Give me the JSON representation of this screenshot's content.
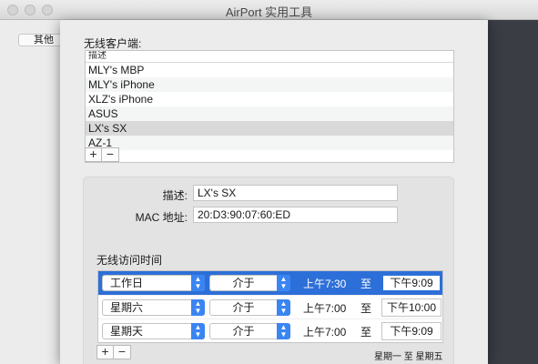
{
  "window": {
    "title": "AirPort 实用工具"
  },
  "background": {
    "other_button_label": "其他"
  },
  "clients": {
    "label": "无线客户端:",
    "column_header": "描述",
    "items": [
      "MLY's MBP",
      "MLY's iPhone",
      "XLZ's iPhone",
      "ASUS",
      "LX's SX",
      "AZ-1"
    ],
    "selected_index": 4,
    "add_label": "+",
    "remove_label": "−"
  },
  "details": {
    "description_label": "描述:",
    "description_value": "LX's SX",
    "mac_label": "MAC 地址:",
    "mac_value": "20:D3:90:07:60:ED"
  },
  "schedule": {
    "title": "无线访问时间",
    "rows": [
      {
        "day": "工作日",
        "mode": "介于",
        "start": "上午7:30",
        "to": "至",
        "end": "下午9:09",
        "selected": true
      },
      {
        "day": "星期六",
        "mode": "介于",
        "start": "上午7:00",
        "to": "至",
        "end": "下午10:00",
        "selected": false
      },
      {
        "day": "星期天",
        "mode": "介于",
        "start": "上午7:00",
        "to": "至",
        "end": "下午9:09",
        "selected": false
      }
    ],
    "add_label": "+",
    "remove_label": "−",
    "summary": "星期一 至 星期五"
  },
  "colors": {
    "selection": "#2d6fd8",
    "popup_arrow": "#3a85f2"
  },
  "icons": {
    "popup_arrows": "updown-chevron-icon"
  }
}
